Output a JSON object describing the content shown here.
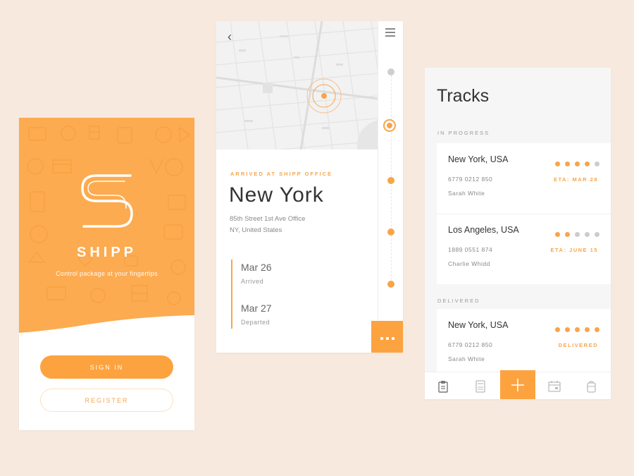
{
  "colors": {
    "background": "#f8e9df",
    "accent": "#fca33f",
    "accent_text": "#f7a54a",
    "text_dark": "#333333",
    "text_muted": "#8a8a8a"
  },
  "login": {
    "brand": "SHIPP",
    "tagline": "Control package at your fingertips",
    "sign_in_label": "SIGN IN",
    "register_label": "REGISTER",
    "icons": [
      "shipp-s-logo",
      "package-pattern"
    ]
  },
  "detail": {
    "status": "ARRIVED AT SHIPP OFFICE",
    "city": "New York",
    "address_line1": "85th Street 1st Ave Office",
    "address_line2": "NY, United States",
    "events": [
      {
        "date": "Mar 26",
        "label": "Arrived"
      },
      {
        "date": "Mar 27",
        "label": "Departed"
      }
    ],
    "icons": [
      "back-arrow-icon",
      "menu-icon",
      "location-pin-icon",
      "more-icon"
    ]
  },
  "tracks": {
    "title": "Tracks",
    "in_progress_label": "IN PROGRESS",
    "delivered_label": "DELIVERED",
    "in_progress": [
      {
        "place": "New York, USA",
        "number": "6779 0212 850",
        "name": "Sarah White",
        "eta": "ETA: MAR 28",
        "progress": 4,
        "steps": 5
      },
      {
        "place": "Los Angeles, USA",
        "number": "1889 0551 874",
        "name": "Charlie Whidd",
        "eta": "ETA: JUNE 15",
        "progress": 2,
        "steps": 5
      }
    ],
    "delivered": [
      {
        "place": "New York, USA",
        "number": "6779 0212 850",
        "name": "Sarah White",
        "eta": "DELIVERED",
        "progress": 5,
        "steps": 5
      }
    ],
    "tabs": [
      "clipboard-icon",
      "calculator-icon",
      "plus-icon",
      "calendar-icon",
      "mug-icon"
    ]
  }
}
